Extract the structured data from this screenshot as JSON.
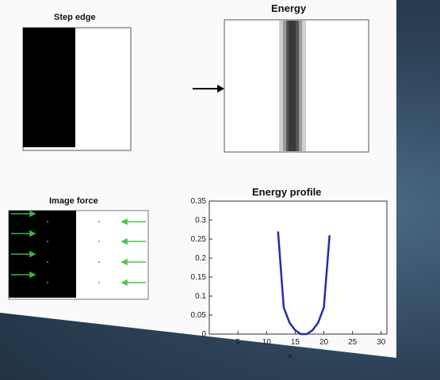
{
  "slide": {
    "step_edge_title": "Step edge",
    "energy_title": "Energy",
    "image_force_title": "Image force",
    "energy_profile_title": "Energy profile"
  },
  "chart_data": {
    "type": "line",
    "title": "Energy profile",
    "xlabel": "x",
    "ylabel": "",
    "xlim": [
      0,
      31
    ],
    "ylim": [
      0,
      0.35
    ],
    "xticks": [
      5,
      10,
      15,
      20,
      25,
      30
    ],
    "yticks": [
      0,
      0.05,
      0.1,
      0.15,
      0.2,
      0.25,
      0.3,
      0.35
    ],
    "ytick_labels": [
      "0",
      "0.05",
      "0.1",
      "0.15",
      "0.2",
      "0.25",
      "0.3",
      "0.35"
    ],
    "grid": false,
    "series": [
      {
        "color": "#2a2aa8",
        "x": [
          12,
          13,
          14,
          15,
          16,
          17,
          18,
          19,
          20,
          21
        ],
        "y": [
          0.27,
          0.07,
          0.03,
          0.01,
          0.0,
          0.0,
          0.01,
          0.03,
          0.07,
          0.26
        ]
      }
    ]
  }
}
